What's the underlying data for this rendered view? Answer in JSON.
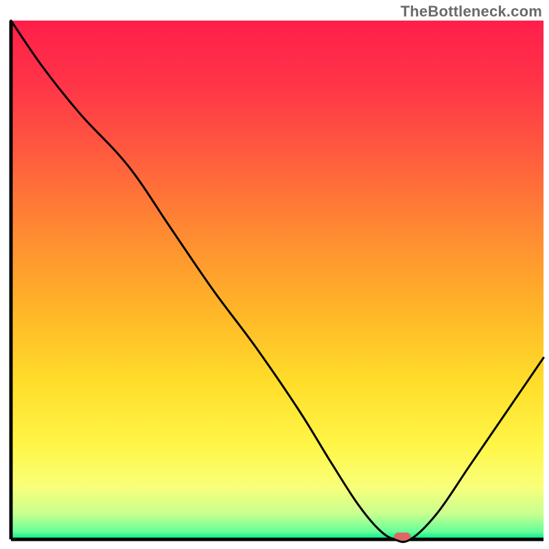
{
  "watermark": "TheBottleneck.com",
  "chart_data": {
    "type": "line",
    "title": "",
    "xlabel": "",
    "ylabel": "",
    "xlim": [
      0,
      100
    ],
    "ylim": [
      0,
      100
    ],
    "grid": false,
    "legend": false,
    "x": [
      0,
      6,
      13,
      22,
      30,
      38,
      46,
      54,
      60,
      65,
      69,
      72,
      75,
      80,
      86,
      92,
      100
    ],
    "values": [
      100,
      91,
      82,
      72,
      60,
      48,
      37,
      25,
      15,
      7,
      2,
      0,
      0,
      5,
      14,
      23,
      35
    ],
    "gradient_stops": [
      {
        "offset": 0.0,
        "color": "#ff1f4a"
      },
      {
        "offset": 0.12,
        "color": "#ff3448"
      },
      {
        "offset": 0.25,
        "color": "#ff593f"
      },
      {
        "offset": 0.4,
        "color": "#ff8833"
      },
      {
        "offset": 0.55,
        "color": "#ffb328"
      },
      {
        "offset": 0.7,
        "color": "#ffde2a"
      },
      {
        "offset": 0.82,
        "color": "#fff648"
      },
      {
        "offset": 0.9,
        "color": "#f8ff7a"
      },
      {
        "offset": 0.95,
        "color": "#c9ff8f"
      },
      {
        "offset": 0.985,
        "color": "#66ff99"
      },
      {
        "offset": 1.0,
        "color": "#00e58a"
      }
    ],
    "marker": {
      "x": 73.5,
      "y": 0,
      "color": "#e06666",
      "rx": 12,
      "ry": 6
    }
  }
}
